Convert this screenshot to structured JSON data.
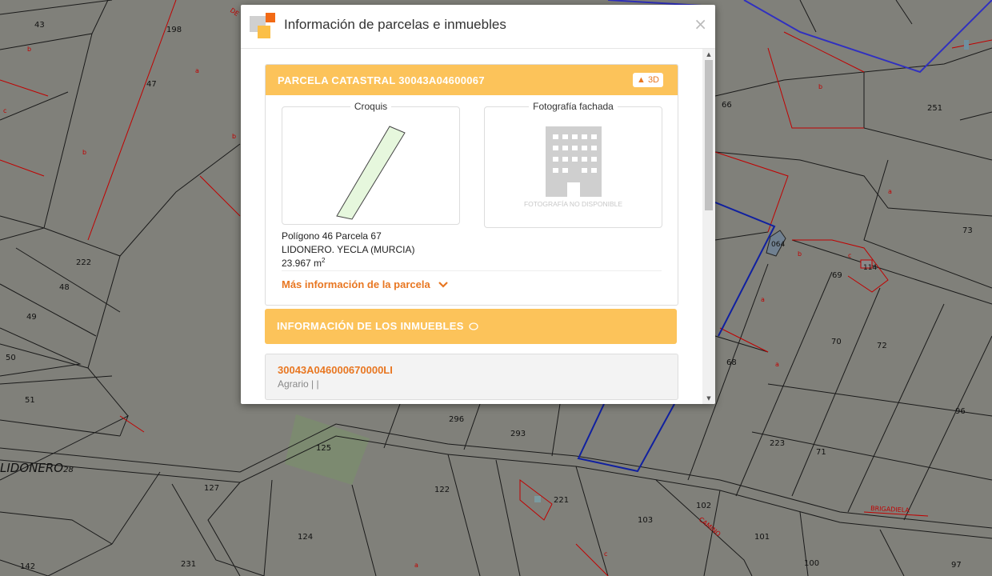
{
  "map": {
    "parcel_numbers": [
      "43",
      "198",
      "47",
      "222",
      "48",
      "49",
      "50",
      "51",
      "296",
      "293",
      "125",
      "127",
      "122",
      "124",
      "231",
      "142",
      "66",
      "251",
      "73",
      "064",
      "69",
      "114",
      "70",
      "72",
      "68",
      "96",
      "223",
      "71",
      "221",
      "103",
      "102",
      "101",
      "100",
      "97"
    ],
    "sub_labels": [
      "b",
      "c",
      "b",
      "a",
      "b",
      "b",
      "a",
      "c",
      "b",
      "a",
      "a",
      "c",
      "a"
    ],
    "place_label": "LIDONERO",
    "place_suffix": "28",
    "road_labels": [
      "BRIGADIELA",
      "CAMINO",
      "DE"
    ]
  },
  "modal": {
    "title": "Información de parcelas e inmuebles",
    "close": "×",
    "parcel_panel": {
      "header": "PARCELA CATASTRAL 30043A04600067",
      "button_3d": "3D",
      "sketch_label": "Croquis",
      "photo_label": "Fotografía fachada",
      "no_photo_text": "FOTOGRAFÍA NO DISPONIBLE",
      "polygon_line": "Polígono 46 Parcela 67",
      "location_line": "LIDONERO. YECLA (MURCIA)",
      "area_value": "23.967 m",
      "area_unit_sup": "2",
      "more_info_link": "Más información de la parcela"
    },
    "buildings_panel": {
      "header": "INFORMACIÓN DE LOS INMUEBLES"
    },
    "building_item": {
      "reference": "30043A046000670000LI",
      "use": "Agrario | |"
    }
  }
}
